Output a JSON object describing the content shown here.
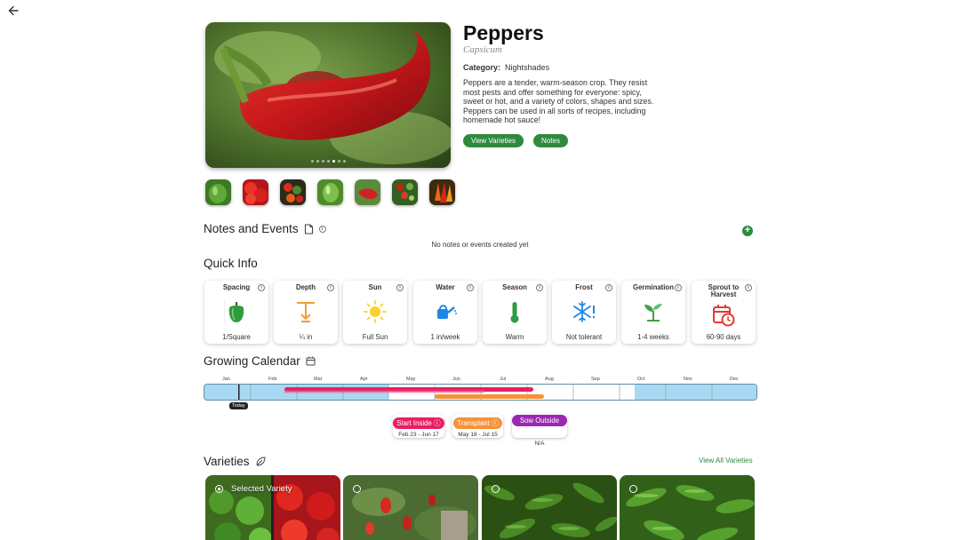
{
  "plant": {
    "name": "Peppers",
    "scientific": "Capsicum",
    "category_label": "Category:",
    "category": "Nightshades",
    "description": "Peppers are a tender, warm-season crop. They resist most pests and offer something for everyone: spicy, sweet or hot, and a variety of colors, shapes and sizes. Peppers can be used in all sorts of recipes, including homemade hot sauce!",
    "view_varieties_label": "View Varieties",
    "notes_label": "Notes"
  },
  "notes": {
    "title": "Notes and Events",
    "empty": "No notes or events created yet"
  },
  "quick_info": {
    "title": "Quick Info",
    "cards": [
      {
        "label": "Spacing",
        "value": "1/Square",
        "icon": "pepper-icon"
      },
      {
        "label": "Depth",
        "value": "¼ in",
        "icon": "depth-icon"
      },
      {
        "label": "Sun",
        "value": "Full Sun",
        "icon": "sun-icon"
      },
      {
        "label": "Water",
        "value": "1 in/week",
        "icon": "watering-can-icon"
      },
      {
        "label": "Season",
        "value": "Warm",
        "icon": "thermometer-icon"
      },
      {
        "label": "Frost",
        "value": "Not tolerant",
        "icon": "snowflake-icon"
      },
      {
        "label": "Germination",
        "value": "1-4 weeks",
        "icon": "sprout-icon"
      },
      {
        "label": "Sprout to Harvest",
        "value": "60-90 days",
        "icon": "calendar-clock-icon"
      }
    ]
  },
  "calendar": {
    "title": "Growing Calendar",
    "months": [
      "Jan",
      "Feb",
      "Mar",
      "Apr",
      "May",
      "Jun",
      "Jul",
      "Aug",
      "Sep",
      "Oct",
      "Nov",
      "Dec"
    ],
    "today_label": "Today",
    "legend": [
      {
        "label": "Start Inside",
        "dates": "Feb 23 - Jun 17",
        "color": "#e91e63"
      },
      {
        "label": "Transplant",
        "dates": "May 18 - Jul 15",
        "color": "#f6923a"
      },
      {
        "label": "Sow Outside",
        "dates": "N/A",
        "color": "#9c27b0"
      }
    ]
  },
  "varieties": {
    "title": "Varieties",
    "view_all": "View All Varieties",
    "selected_label": "Selected Variety"
  },
  "colors": {
    "accent": "#2e8b3e",
    "frost_season": "#a9d9f2",
    "start_inside": "#e91e63",
    "transplant": "#f6923a"
  }
}
